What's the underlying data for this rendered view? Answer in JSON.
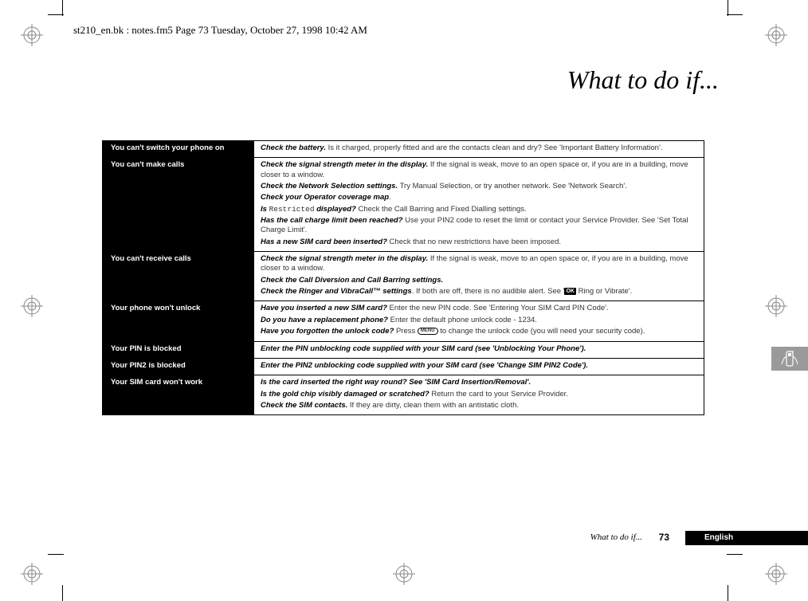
{
  "header": "st210_en.bk : notes.fm5  Page 73  Tuesday, October 27, 1998  10:42 AM",
  "title": "What to do if...",
  "rows": [
    {
      "problem": "You can't switch your phone on",
      "solutions": [
        {
          "lead": "Check the battery.",
          "rest": " Is it charged, properly fitted and are the contacts clean and dry? See 'Important Battery Information'."
        }
      ]
    },
    {
      "problem": "You can't make calls",
      "solutions": [
        {
          "lead": "Check the signal strength meter in the display.",
          "rest": " If the signal is weak, move to an open space or, if you are in a building, move closer to a window."
        },
        {
          "lead": "Check the Network Selection settings.",
          "rest": " Try Manual Selection, or try another network. See 'Network Search'."
        },
        {
          "lead": "Check your Operator coverage map",
          "rest": "."
        },
        {
          "lead": "Is ",
          "mono": "Restricted",
          "lead2": " displayed?",
          "rest": " Check the Call Barring and Fixed Dialling settings."
        },
        {
          "lead": "Has the call charge limit been reached?",
          "rest": " Use your PIN2 code to reset the limit or contact your Service Provider. See 'Set Total Charge Limit'."
        },
        {
          "lead": "Has a new SIM card been inserted?",
          "rest": " Check that no new restrictions have been imposed."
        }
      ]
    },
    {
      "problem": "You can't receive calls",
      "solutions": [
        {
          "lead": "Check the signal strength meter in the display.",
          "rest": " If the signal is weak, move to an open space or, if you are in a building, move closer to a window."
        },
        {
          "lead": "Check the Call Diversion and Call Barring settings.",
          "rest": ""
        },
        {
          "lead": "Check the Ringer and VibraCall™ settings",
          "rest": ". If both are off, there is no audible alert. See '",
          "ok": true,
          "rest2": " Ring or Vibrate'."
        }
      ]
    },
    {
      "problem": "Your phone won't unlock",
      "solutions": [
        {
          "lead": "Have you inserted a new SIM card?",
          "rest": " Enter the new PIN code. See 'Entering Your SIM Card PIN Code'."
        },
        {
          "lead": "Do you have a replacement phone?",
          "rest": " Enter the default phone unlock code - 1234."
        },
        {
          "lead": "Have you forgotten the unlock code?",
          "rest": " Press ",
          "menu": true,
          "rest2": " to change the unlock code (you will need your security code)."
        }
      ]
    },
    {
      "problem": "Your PIN is blocked",
      "solutions": [
        {
          "lead": "Enter the PIN unblocking code supplied with your SIM card (see 'Unblocking Your Phone').",
          "rest": ""
        }
      ]
    },
    {
      "problem": "Your PIN2 is blocked",
      "solutions": [
        {
          "lead": "Enter the PIN2 unblocking code supplied with your SIM card (see 'Change SIM PIN2 Code').",
          "rest": ""
        }
      ]
    },
    {
      "problem": "Your SIM card won't work",
      "solutions": [
        {
          "lead": "Is the card inserted the right way round? See 'SIM Card Insertion/Removal'.",
          "rest": ""
        },
        {
          "lead": "Is the gold chip visibly damaged or scratched?",
          "rest": " Return the card to your Service Provider."
        },
        {
          "lead": "Check the SIM contacts.",
          "rest": " If they are dirty, clean them with an antistatic cloth."
        }
      ]
    }
  ],
  "footer": {
    "text": "What to do if...",
    "page": "73",
    "lang": "English"
  },
  "icons": {
    "ok": "OK",
    "menu": "MENU"
  }
}
